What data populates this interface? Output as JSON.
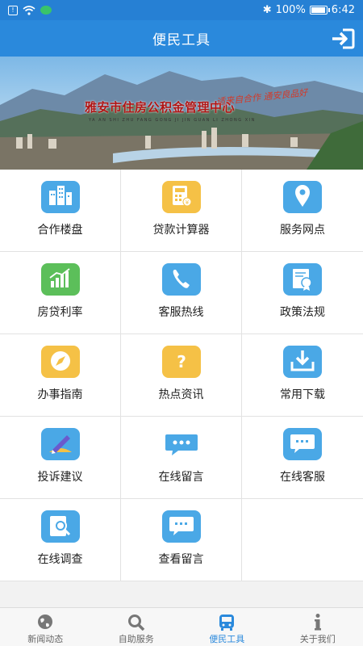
{
  "status_bar": {
    "battery": "100%",
    "time": "6:42"
  },
  "header": {
    "title": "便民工具"
  },
  "banner": {
    "title": "雅安市住房公积金管理中心",
    "subtitle": "YA AN SHI ZHU FANG GONG JI JIN GUAN LI ZHONG XIN",
    "slogan": "适来自合作  通安良品好"
  },
  "tools": [
    {
      "label": "合作楼盘",
      "icon": "buildings-icon",
      "color": "#4aa8e6"
    },
    {
      "label": "贷款计算器",
      "icon": "calculator-icon",
      "color": "#f5c146"
    },
    {
      "label": "服务网点",
      "icon": "location-pin-icon",
      "color": "#4aa8e6"
    },
    {
      "label": "房贷利率",
      "icon": "rate-chart-icon",
      "color": "#5cbf5a"
    },
    {
      "label": "客服热线",
      "icon": "phone-icon",
      "color": "#4aa8e6"
    },
    {
      "label": "政策法规",
      "icon": "certificate-icon",
      "color": "#4aa8e6"
    },
    {
      "label": "办事指南",
      "icon": "compass-icon",
      "color": "#f5c146"
    },
    {
      "label": "热点资讯",
      "icon": "question-icon",
      "color": "#f5c146"
    },
    {
      "label": "常用下载",
      "icon": "download-icon",
      "color": "#4aa8e6"
    },
    {
      "label": "投诉建议",
      "icon": "pencil-icon",
      "color": "#4aa8e6"
    },
    {
      "label": "在线留言",
      "icon": "chat-bubble-icon",
      "color": "#4aa8e6"
    },
    {
      "label": "在线客服",
      "icon": "chat-icon",
      "color": "#4aa8e6"
    },
    {
      "label": "在线调查",
      "icon": "survey-search-icon",
      "color": "#4aa8e6"
    },
    {
      "label": "查看留言",
      "icon": "message-view-icon",
      "color": "#4aa8e6"
    }
  ],
  "tab_bar": {
    "tabs": [
      {
        "label": "新闻动态",
        "icon": "globe-icon",
        "active": false
      },
      {
        "label": "自助服务",
        "icon": "search-icon",
        "active": false
      },
      {
        "label": "便民工具",
        "icon": "bus-icon",
        "active": true
      },
      {
        "label": "关于我们",
        "icon": "info-icon",
        "active": false
      }
    ]
  },
  "colors": {
    "primary": "#2a89dc",
    "status_bar": "#2680d4",
    "icon_blue": "#4aa8e6",
    "icon_yellow": "#f5c146",
    "icon_green": "#5cbf5a"
  }
}
